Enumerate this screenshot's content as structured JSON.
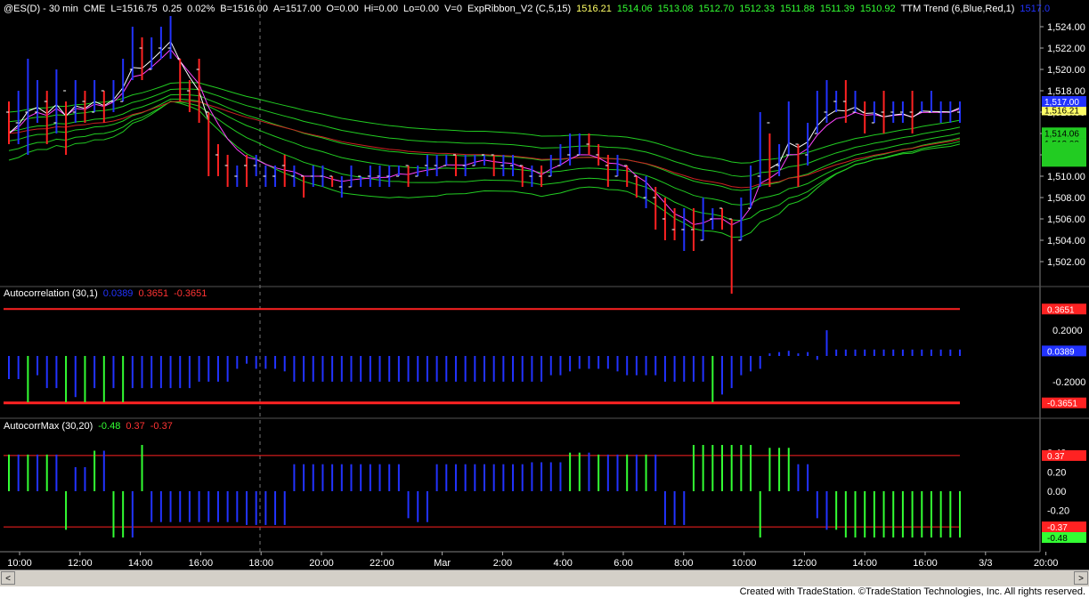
{
  "panel1": {
    "header": [
      "@ES(D) - 30 min",
      "CME",
      "L=1516.75",
      "0.25",
      "0.02%",
      "B=1516.00",
      "A=1517.00",
      "O=0.00",
      "Hi=0.00",
      "Lo=0.00",
      "V=0",
      "ExpRibbon_V2 (C,5,15)",
      "1516.21",
      "1514.06",
      "1513.08",
      "1512.70",
      "1512.33",
      "1511.88",
      "1511.39",
      "1510.92",
      "TTM Trend (6,Blue,Red,1)",
      "1517.0"
    ],
    "header_colors": [
      "#ffffff",
      "#ffffff",
      "#ffffff",
      "#ffffff",
      "#ffffff",
      "#ffffff",
      "#ffffff",
      "#ffffff",
      "#ffffff",
      "#ffffff",
      "#ffffff",
      "#ffffff",
      "#ffff66",
      "#33ff33",
      "#33ff33",
      "#33ff33",
      "#33ff33",
      "#33ff33",
      "#33ff33",
      "#33ff33",
      "#ffffff",
      "#2233ff"
    ]
  },
  "panel2": {
    "header": [
      "Autocorrelation (30,1)",
      "0.0389",
      "0.3651",
      "-0.3651"
    ],
    "header_colors": [
      "#ffffff",
      "#2233ff",
      "#ff3333",
      "#ff3333"
    ]
  },
  "panel3": {
    "header": [
      "AutocorrMax (30,20)",
      "-0.48",
      "0.37",
      "-0.37"
    ],
    "header_colors": [
      "#ffffff",
      "#33ff33",
      "#ff3333",
      "#ff3333"
    ]
  },
  "footer": "Created with TradeStation. ©TradeStation Technologies, Inc. All rights reserved.",
  "scroll": {
    "left_arrow": "<",
    "right_arrow": ">"
  },
  "colors": {
    "background": "#000000",
    "grid": "#3a3a3a",
    "up_bar": "#2233ff",
    "down_bar": "#ff2222",
    "ribbon": "#22cc22",
    "ribbon_slow": "#cc2222",
    "ttm_line": "#ffffff",
    "pink_line": "#ff44ff",
    "green_hist": "#33ff33",
    "blue_hist": "#2233ff",
    "threshold": "#ff2222"
  },
  "chart_data": [
    {
      "type": "bar",
      "title": "@ES(D) - 30 min",
      "ylim": [
        1500,
        1525
      ],
      "yticks": [
        "1,502.00",
        "1,504.00",
        "1,506.00",
        "1,508.00",
        "1,510.00",
        "1,512.00",
        "1,514.00",
        "1,516.00",
        "1,518.00",
        "1,520.00",
        "1,522.00",
        "1,524.00"
      ],
      "xticks": [
        "10:00",
        "12:00",
        "14:00",
        "16:00",
        "18:00",
        "20:00",
        "22:00",
        "Mar",
        "2:00",
        "4:00",
        "6:00",
        "8:00",
        "10:00",
        "12:00",
        "14:00",
        "16:00",
        "3/3",
        "20:00"
      ],
      "value_labels": [
        "1,516.75",
        "1,516.21",
        "1,514.06",
        "1,513.08",
        "1,517.00"
      ],
      "bars": [
        [
          1517,
          1513,
          1516,
          1514
        ],
        [
          1518,
          1513,
          1515,
          1516
        ],
        [
          1521,
          1512,
          1516,
          1518
        ],
        [
          1519,
          1515,
          1516,
          1517
        ],
        [
          1518,
          1513,
          1517,
          1515
        ],
        [
          1520,
          1514,
          1515,
          1518
        ],
        [
          1517,
          1512,
          1518,
          1514
        ],
        [
          1519,
          1515,
          1516,
          1518
        ],
        [
          1518,
          1515,
          1517,
          1516
        ],
        [
          1519,
          1516,
          1516,
          1518
        ],
        [
          1518,
          1515,
          1518,
          1516
        ],
        [
          1519,
          1516,
          1517,
          1518
        ],
        [
          1521,
          1517,
          1517,
          1520
        ],
        [
          1524,
          1519,
          1520,
          1523
        ],
        [
          1523,
          1519,
          1522,
          1520
        ],
        [
          1523,
          1520,
          1520,
          1522
        ],
        [
          1524,
          1521,
          1522,
          1523
        ],
        [
          1525,
          1521,
          1522,
          1524
        ],
        [
          1521,
          1517,
          1521,
          1518
        ],
        [
          1519,
          1516,
          1518,
          1517
        ],
        [
          1521,
          1515,
          1520,
          1516
        ],
        [
          1516,
          1510,
          1516,
          1511
        ],
        [
          1513,
          1510,
          1512,
          1511
        ],
        [
          1512,
          1509,
          1511,
          1510
        ],
        [
          1511,
          1509,
          1510,
          1510
        ],
        [
          1512,
          1509,
          1511,
          1510
        ],
        [
          1512,
          1510,
          1511,
          1511
        ],
        [
          1511,
          1509,
          1510,
          1510
        ],
        [
          1511,
          1509,
          1510,
          1510
        ],
        [
          1512,
          1509,
          1511,
          1510
        ],
        [
          1511,
          1509,
          1510,
          1510
        ],
        [
          1510,
          1508,
          1510,
          1509
        ],
        [
          1511,
          1509,
          1510,
          1510
        ],
        [
          1511,
          1509,
          1510,
          1510
        ],
        [
          1510,
          1509,
          1510,
          1509
        ],
        [
          1510,
          1508,
          1509,
          1509
        ],
        [
          1511,
          1509,
          1509,
          1510
        ],
        [
          1510,
          1509,
          1510,
          1510
        ],
        [
          1511,
          1509,
          1510,
          1510
        ],
        [
          1511,
          1509,
          1510,
          1510
        ],
        [
          1511,
          1509,
          1510,
          1510
        ],
        [
          1511,
          1510,
          1510,
          1511
        ],
        [
          1511,
          1509,
          1511,
          1510
        ],
        [
          1511,
          1510,
          1510,
          1511
        ],
        [
          1512,
          1510,
          1511,
          1511
        ],
        [
          1512,
          1510,
          1511,
          1511
        ],
        [
          1512,
          1511,
          1511,
          1512
        ],
        [
          1512,
          1510,
          1512,
          1511
        ],
        [
          1512,
          1510,
          1511,
          1511
        ],
        [
          1512,
          1511,
          1511,
          1512
        ],
        [
          1512,
          1511,
          1512,
          1512
        ],
        [
          1512,
          1510,
          1512,
          1511
        ],
        [
          1512,
          1510,
          1511,
          1511
        ],
        [
          1512,
          1510,
          1511,
          1511
        ],
        [
          1511,
          1509,
          1511,
          1510
        ],
        [
          1511,
          1509,
          1510,
          1510
        ],
        [
          1511,
          1509,
          1510,
          1509
        ],
        [
          1512,
          1510,
          1510,
          1512
        ],
        [
          1513,
          1511,
          1511,
          1512
        ],
        [
          1514,
          1511,
          1512,
          1513
        ],
        [
          1514,
          1512,
          1512,
          1513
        ],
        [
          1514,
          1512,
          1513,
          1512
        ],
        [
          1513,
          1511,
          1512,
          1511
        ],
        [
          1512,
          1509,
          1511,
          1510
        ],
        [
          1512,
          1510,
          1510,
          1511
        ],
        [
          1511,
          1509,
          1511,
          1510
        ],
        [
          1510,
          1508,
          1510,
          1508
        ],
        [
          1510,
          1507,
          1508,
          1508
        ],
        [
          1509,
          1505,
          1508,
          1506
        ],
        [
          1508,
          1504,
          1506,
          1505
        ],
        [
          1507,
          1504,
          1505,
          1504
        ],
        [
          1507,
          1503,
          1505,
          1505
        ],
        [
          1507,
          1503,
          1505,
          1504
        ],
        [
          1508,
          1504,
          1504,
          1506
        ],
        [
          1507,
          1505,
          1506,
          1507
        ],
        [
          1507,
          1505,
          1507,
          1506
        ],
        [
          1506,
          1499,
          1506,
          1504
        ],
        [
          1508,
          1504,
          1504,
          1507
        ],
        [
          1511,
          1507,
          1507,
          1510
        ],
        [
          1516,
          1509,
          1510,
          1515
        ],
        [
          1514,
          1509,
          1515,
          1511
        ],
        [
          1513,
          1510,
          1511,
          1512
        ],
        [
          1517,
          1512,
          1512,
          1516
        ],
        [
          1513,
          1509,
          1513,
          1512
        ],
        [
          1515,
          1511,
          1512,
          1514
        ],
        [
          1518,
          1514,
          1514,
          1517
        ],
        [
          1519,
          1515,
          1516,
          1517
        ],
        [
          1518,
          1516,
          1517,
          1517
        ],
        [
          1519,
          1515,
          1517,
          1516
        ],
        [
          1518,
          1516,
          1516,
          1517
        ],
        [
          1517,
          1514,
          1516,
          1515
        ],
        [
          1517,
          1515,
          1515,
          1516
        ],
        [
          1518,
          1514,
          1516,
          1515
        ],
        [
          1517,
          1515,
          1516,
          1516
        ],
        [
          1517,
          1515,
          1516,
          1516
        ],
        [
          1518,
          1514,
          1516,
          1515
        ],
        [
          1517,
          1516,
          1516,
          1517
        ],
        [
          1518,
          1516,
          1516,
          1516
        ],
        [
          1517,
          1515,
          1516,
          1516
        ],
        [
          1517,
          1515,
          1516,
          1516
        ],
        [
          1517,
          1515,
          1516,
          1517
        ]
      ]
    },
    {
      "type": "bar",
      "title": "Autocorrelation (30,1)",
      "ylim": [
        -0.45,
        0.45
      ],
      "yticks": [
        "0.2000",
        "-0.2000"
      ],
      "threshold": [
        0.3651,
        -0.3651
      ],
      "value_labels": [
        "0.3651",
        "0.0389",
        "-0.3651"
      ],
      "values": [
        -0.18,
        -0.18,
        -0.36,
        -0.15,
        -0.25,
        -0.25,
        -0.36,
        -0.32,
        -0.36,
        -0.25,
        -0.36,
        -0.25,
        -0.36,
        -0.25,
        -0.25,
        -0.25,
        -0.25,
        -0.25,
        -0.25,
        -0.25,
        -0.2,
        -0.2,
        -0.2,
        -0.2,
        -0.1,
        -0.06,
        -0.1,
        -0.1,
        -0.1,
        -0.12,
        -0.2,
        -0.2,
        -0.2,
        -0.2,
        -0.2,
        -0.2,
        -0.2,
        -0.2,
        -0.2,
        -0.2,
        -0.2,
        -0.2,
        -0.2,
        -0.2,
        -0.2,
        -0.2,
        -0.2,
        -0.2,
        -0.2,
        -0.2,
        -0.2,
        -0.2,
        -0.2,
        -0.2,
        -0.2,
        -0.2,
        -0.2,
        -0.15,
        -0.15,
        -0.12,
        -0.1,
        -0.1,
        -0.1,
        -0.1,
        -0.12,
        -0.15,
        -0.15,
        -0.15,
        -0.15,
        -0.2,
        -0.2,
        -0.2,
        -0.2,
        -0.2,
        -0.36,
        -0.3,
        -0.25,
        -0.15,
        -0.12,
        -0.1,
        0.02,
        0.03,
        0.04,
        0.02,
        0.03,
        -0.03,
        0.2,
        0.05,
        0.05,
        0.05,
        0.05,
        0.05,
        0.05,
        0.05,
        0.05,
        0.05,
        0.05,
        0.05,
        0.05,
        0.05,
        0.05
      ],
      "colors": [
        "b",
        "b",
        "g",
        "b",
        "b",
        "b",
        "g",
        "b",
        "g",
        "b",
        "g",
        "b",
        "g",
        "b",
        "b",
        "b",
        "b",
        "b",
        "b",
        "b",
        "b",
        "b",
        "b",
        "b",
        "b",
        "b",
        "b",
        "b",
        "b",
        "b",
        "b",
        "b",
        "b",
        "b",
        "b",
        "b",
        "b",
        "b",
        "b",
        "b",
        "b",
        "b",
        "b",
        "b",
        "b",
        "b",
        "b",
        "b",
        "b",
        "b",
        "b",
        "b",
        "b",
        "b",
        "b",
        "b",
        "b",
        "b",
        "b",
        "b",
        "b",
        "b",
        "b",
        "b",
        "b",
        "b",
        "b",
        "b",
        "b",
        "b",
        "b",
        "b",
        "b",
        "b",
        "g",
        "b",
        "b",
        "b",
        "b",
        "b",
        "b",
        "b",
        "b",
        "b",
        "b",
        "b",
        "b",
        "b",
        "b",
        "b",
        "b",
        "b",
        "b",
        "b",
        "b",
        "b",
        "b",
        "b",
        "b",
        "b",
        "b"
      ]
    },
    {
      "type": "bar",
      "title": "AutocorrMax (30,20)",
      "ylim": [
        -0.6,
        0.6
      ],
      "yticks": [
        "0.40",
        "0.20",
        "0.00",
        "-0.20",
        "-0.40"
      ],
      "threshold": [
        0.37,
        -0.37
      ],
      "value_labels": [
        "0.37",
        "-0.37",
        "-0.48"
      ],
      "values": [
        0.38,
        0.38,
        0.38,
        0.38,
        0.38,
        0.38,
        -0.4,
        0.25,
        0.25,
        0.42,
        0.42,
        -0.48,
        -0.48,
        -0.48,
        0.48,
        -0.32,
        -0.32,
        -0.32,
        -0.32,
        -0.32,
        -0.32,
        -0.32,
        -0.32,
        -0.32,
        -0.32,
        -0.35,
        -0.35,
        -0.35,
        -0.35,
        -0.35,
        0.28,
        0.28,
        0.28,
        0.28,
        0.28,
        0.28,
        0.28,
        0.28,
        0.28,
        0.28,
        0.28,
        0.28,
        -0.28,
        -0.32,
        -0.32,
        0.28,
        0.28,
        0.28,
        0.28,
        0.28,
        0.28,
        0.28,
        0.28,
        0.28,
        0.28,
        0.3,
        0.3,
        0.3,
        0.3,
        0.4,
        0.4,
        0.4,
        0.38,
        0.38,
        0.38,
        0.38,
        0.38,
        0.38,
        0.38,
        -0.35,
        -0.35,
        -0.35,
        0.48,
        0.48,
        0.48,
        0.48,
        0.48,
        0.48,
        0.48,
        -0.48,
        0.45,
        0.45,
        0.45,
        0.28,
        0.28,
        -0.28,
        -0.4,
        -0.4,
        -0.48,
        -0.48,
        -0.48,
        -0.48,
        -0.48,
        -0.48,
        -0.48,
        -0.48,
        -0.48,
        -0.48,
        -0.48,
        -0.48,
        -0.48
      ],
      "colors": [
        "g",
        "b",
        "g",
        "b",
        "g",
        "b",
        "g",
        "b",
        "b",
        "g",
        "b",
        "g",
        "g",
        "b",
        "g",
        "b",
        "b",
        "b",
        "b",
        "b",
        "b",
        "b",
        "b",
        "b",
        "b",
        "b",
        "b",
        "b",
        "b",
        "b",
        "b",
        "b",
        "b",
        "b",
        "b",
        "b",
        "b",
        "b",
        "b",
        "b",
        "b",
        "b",
        "b",
        "b",
        "b",
        "b",
        "b",
        "b",
        "b",
        "b",
        "b",
        "b",
        "b",
        "b",
        "b",
        "b",
        "b",
        "b",
        "b",
        "g",
        "g",
        "b",
        "g",
        "b",
        "b",
        "g",
        "b",
        "g",
        "b",
        "b",
        "b",
        "b",
        "g",
        "g",
        "g",
        "g",
        "g",
        "g",
        "g",
        "g",
        "g",
        "g",
        "g",
        "b",
        "b",
        "b",
        "b",
        "g",
        "g",
        "g",
        "g",
        "g",
        "g",
        "g",
        "g",
        "g",
        "g",
        "g",
        "g",
        "g",
        "g"
      ]
    }
  ]
}
